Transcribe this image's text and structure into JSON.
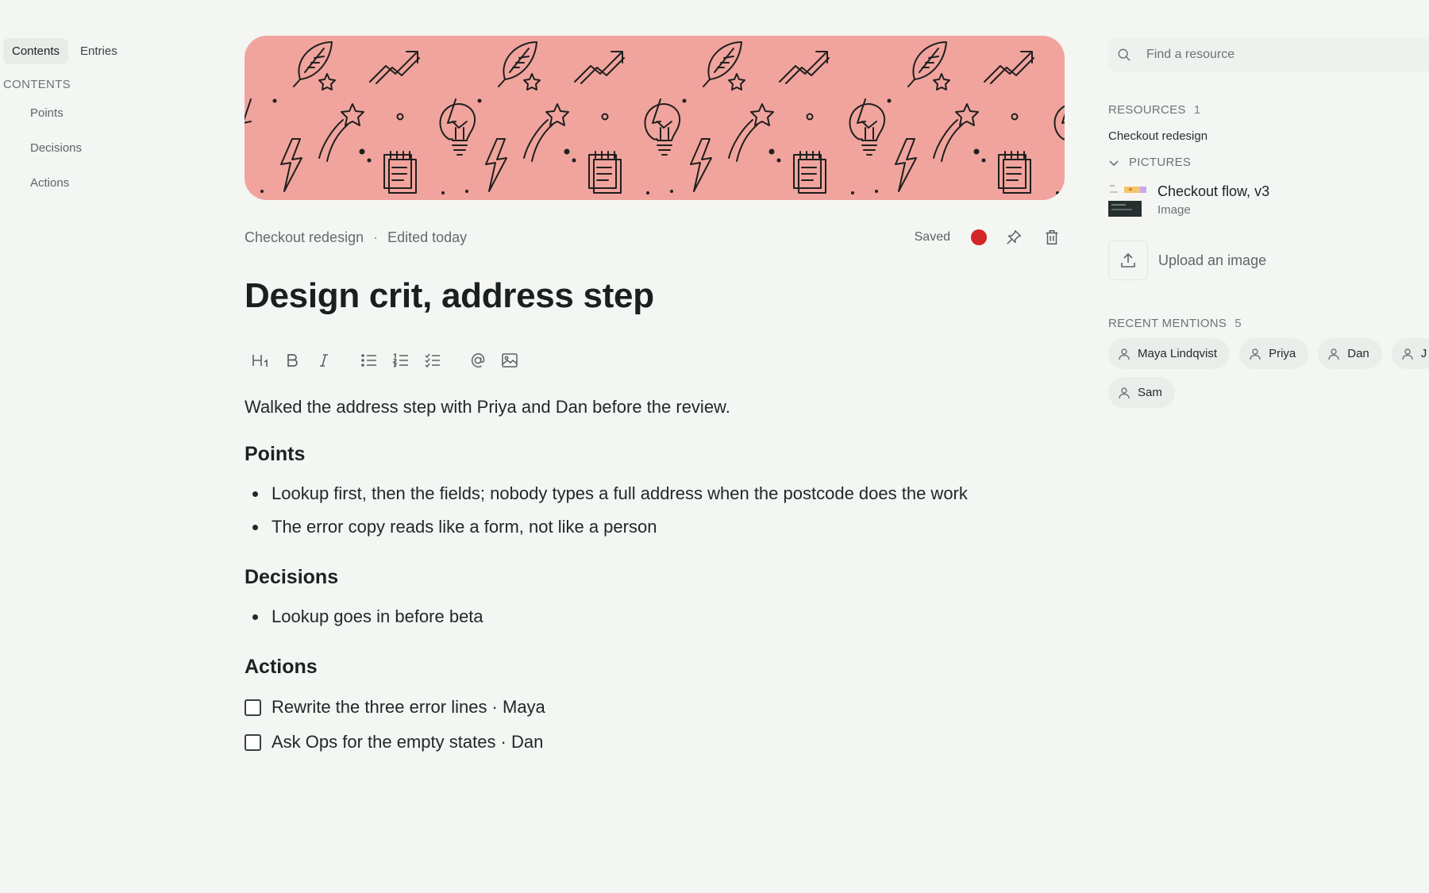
{
  "left_nav": {
    "tabs": [
      {
        "label": "Contents",
        "active": true
      },
      {
        "label": "Entries",
        "active": false
      }
    ],
    "heading": "CONTENTS",
    "items": [
      "Points",
      "Decisions",
      "Actions"
    ]
  },
  "note": {
    "cover_color": "#f0a49d",
    "breadcrumb": "Checkout redesign",
    "separator": "·",
    "edited": "Edited today",
    "saved": "Saved",
    "record_color": "#d42526",
    "title": "Design crit, address step",
    "toolbar": [
      "heading-1-icon",
      "bold-icon",
      "italic-icon",
      "bullet-list-icon",
      "numbered-list-icon",
      "checklist-icon",
      "mention-icon",
      "image-icon"
    ],
    "intro": "Walked the address step with Priya and Dan before the review.",
    "points_heading": "Points",
    "points": [
      "Lookup first, then the fields; nobody types a full address when the postcode does the work",
      "The error copy reads like a form, not like a person"
    ],
    "decisions_heading": "Decisions",
    "decisions": [
      "Lookup goes in before beta"
    ],
    "actions_heading": "Actions",
    "actions": [
      {
        "text": "Rewrite the three error lines · Maya",
        "checked": false
      },
      {
        "text": "Ask Ops for the empty states · Dan",
        "checked": false
      }
    ]
  },
  "right_panel": {
    "search_placeholder": "Find a resource",
    "resources_heading": "RESOURCES",
    "resources_count": "1",
    "resource_link": "Checkout redesign",
    "pictures_heading": "PICTURES",
    "picture_title": "Checkout flow, v3",
    "picture_type": "Image",
    "upload_label": "Upload an image",
    "mentions_heading": "RECENT MENTIONS",
    "mentions_count": "5",
    "mentions": [
      "Maya Lindqvist",
      "Priya",
      "Dan",
      "J",
      "Sam"
    ]
  }
}
